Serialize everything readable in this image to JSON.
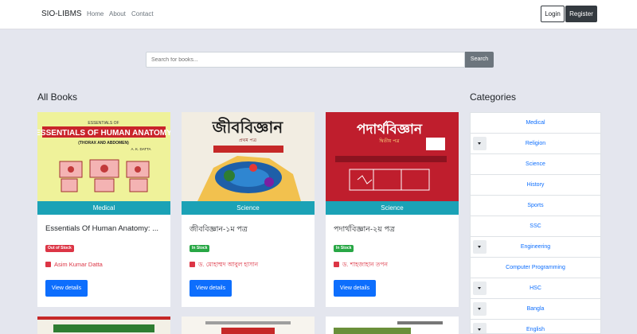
{
  "nav": {
    "brand": "SIO-LIBMS",
    "links": [
      "Home",
      "About",
      "Contact"
    ],
    "login": "Login",
    "register": "Register"
  },
  "search": {
    "placeholder": "Search for books...",
    "button": "Search"
  },
  "books_heading": "All Books",
  "categories_heading": "Categories",
  "books": [
    {
      "cover_title": "ESSENTIALS OF HUMAN ANATOMY",
      "cover_subtitle": "(THORAX AND ABDOMEN)",
      "cover_author": "A. K. DATTA",
      "category": "Medical",
      "title": "Essentials Of Human Anatomy: ...",
      "stock": "Out of Stock",
      "author": "Asim Kumar Datta",
      "button": "View details"
    },
    {
      "cover_title": "জীববিজ্ঞান",
      "cover_subtitle": "প্রথম পত্র",
      "category": "Science",
      "title": "জীববিজ্ঞান-১ম পত্র",
      "stock": "In Stock",
      "author": "ড. মোহাম্মদ আবুল হাসান",
      "button": "View details"
    },
    {
      "cover_title": "পদার্থবিজ্ঞান",
      "cover_subtitle": "দ্বিতীয় পত্র",
      "category": "Science",
      "title": "পদার্থবিজ্ঞান-২য় পত্র",
      "stock": "In Stock",
      "author": "ড. শাহজাহান তপন",
      "button": "View details"
    }
  ],
  "categories": [
    {
      "label": "Medical",
      "has_toggle": false
    },
    {
      "label": "Religion",
      "has_toggle": true
    },
    {
      "label": "Science",
      "has_toggle": false
    },
    {
      "label": "History",
      "has_toggle": false
    },
    {
      "label": "Sports",
      "has_toggle": false
    },
    {
      "label": "SSC",
      "has_toggle": false
    },
    {
      "label": "Engineering",
      "has_toggle": true
    },
    {
      "label": "Computer Programming",
      "has_toggle": false
    },
    {
      "label": "HSC",
      "has_toggle": true
    },
    {
      "label": "Bangla",
      "has_toggle": true
    },
    {
      "label": "English",
      "has_toggle": true
    }
  ],
  "colors": {
    "category_bar": "#1ba2b6",
    "primary": "#0d6efd",
    "danger": "#dc3545",
    "success": "#28a745"
  }
}
